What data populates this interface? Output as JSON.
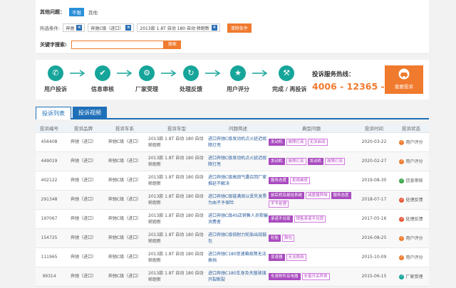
{
  "filters": {
    "other_label": "其他问题：",
    "other_options": [
      "不限",
      "其他"
    ],
    "selected_label": "所选条件:",
    "chips": [
      "奔驰",
      "奔驰C级（进口）",
      "2013款 1.8T 自动 180 自动 轿跑新"
    ],
    "clear_label": "清除条件",
    "keyword_label": "关键字搜索:",
    "keyword_placeholder": "",
    "search_label": "搜索"
  },
  "process": {
    "steps": [
      {
        "label": "用户投诉",
        "icon": "phone-icon",
        "glyph": "✆"
      },
      {
        "label": "信息审核",
        "icon": "check-icon",
        "glyph": "✔"
      },
      {
        "label": "厂家受理",
        "icon": "gear-icon",
        "glyph": "⚙"
      },
      {
        "label": "处理反馈",
        "icon": "refresh-icon",
        "glyph": "↻"
      },
      {
        "label": "用户评分",
        "icon": "star-icon",
        "glyph": "★"
      },
      {
        "label": "完成 / 再投诉",
        "icon": "gavel-icon",
        "glyph": "⚒"
      }
    ],
    "hotline_label": "投诉服务热线：",
    "hotline_number": "4006 - 12365 - 0",
    "complain_label": "我要投诉"
  },
  "tabs": [
    "投诉列表",
    "投诉视频"
  ],
  "table": {
    "headers": [
      "投诉编号",
      "投诉品牌",
      "投诉车系",
      "投诉车型",
      "问题简述",
      "典型问题",
      "投诉时间",
      "投诉状态"
    ],
    "rows": [
      {
        "id": "456408",
        "brand": "奔驰（进口）",
        "series": "奔驰C级（进口）",
        "model": "2013款 1.8T 自动 180 自动 轿跑新",
        "summary": "进口奔驰C级发动机点火延迟故障灯亮",
        "tags": [
          {
            "t": "发动机",
            "k": "p"
          },
          {
            "t": "故障灯亮",
            "k": "o"
          },
          {
            "t": "无法启动",
            "k": "o"
          }
        ],
        "date": "2020-03-22",
        "status": "用户评分",
        "scolor": "#f07a2e"
      },
      {
        "id": "449019",
        "brand": "奔驰（进口）",
        "series": "奔驰C级（进口）",
        "model": "2013款 1.8T 自动 180 自动 轿跑新",
        "summary": "进口奔驰C级发动机点火延迟故障灯亮",
        "tags": [
          {
            "t": "发动机",
            "k": "p"
          },
          {
            "t": "故障灯亮",
            "k": "o"
          },
          {
            "t": "发动机",
            "k": "p"
          },
          {
            "t": "故障灯亮",
            "k": "o"
          }
        ],
        "date": "2020-02-27",
        "status": "用户评分",
        "scolor": "#f07a2e"
      },
      {
        "id": "402122",
        "brand": "奔驰（进口）",
        "series": "奔驰C级（进口）",
        "model": "2013款 1.8T 自动 180 自动 轿跑新",
        "summary": "进口奔驰C级高田气囊召回厂家推延不解决",
        "tags": [
          {
            "t": "服务态度",
            "k": "p"
          },
          {
            "t": "拒绝维修",
            "k": "o"
          }
        ],
        "date": "2019-08-30",
        "status": "信息审核",
        "scolor": "#3aa64a"
      },
      {
        "id": "291348",
        "brand": "奔驰（进口）",
        "series": "奔驰C级（进口）",
        "model": "2013款 1.8T 自动 180 自动 轿跑新",
        "summary": "进口奔驰C级链满周以丢失发票为由不予保险",
        "tags": [
          {
            "t": "前后桥及悬挂系统",
            "k": "p"
          },
          {
            "t": "减震器异响",
            "k": "o"
          },
          {
            "t": "服务态度",
            "k": "p"
          },
          {
            "t": "不予处理",
            "k": "o"
          }
        ],
        "date": "2018-07-17",
        "status": "处理反馈",
        "scolor": "#e85a3a"
      },
      {
        "id": "197067",
        "brand": "奔驰（进口）",
        "series": "奔驰C级（进口）",
        "model": "2013款 1.8T 自动 180 自动 轿跑新",
        "summary": "进口奔驰C级4S店销售人员欺骗消费者",
        "tags": [
          {
            "t": "承诺不兑现",
            "k": "p"
          },
          {
            "t": "销售承诺不兑现",
            "k": "o"
          }
        ],
        "date": "2017-05-16",
        "status": "处理反馈",
        "scolor": "#e85a3a"
      },
      {
        "id": "154725",
        "brand": "奔驰（进口）",
        "series": "奔驰C级（进口）",
        "model": "2013款 1.8T 自动 180 自动 轿跑新",
        "summary": "进口奔驰C级倍耐力轮胎出现鼓包",
        "tags": [
          {
            "t": "轮胎",
            "k": "p"
          },
          {
            "t": "鼓包",
            "k": "o"
          }
        ],
        "date": "2016-08-25",
        "status": "用户评分",
        "scolor": "#f07a2e"
      },
      {
        "id": "111965",
        "brand": "奔驰（进口）",
        "series": "奔驰C级（进口）",
        "model": "2013款 1.8T 自动 180 自动 轿跑新",
        "summary": "进口奔驰C180变速箱故障无法换挡",
        "tags": [
          {
            "t": "变速器",
            "k": "p"
          },
          {
            "t": "无法换挡",
            "k": "o"
          }
        ],
        "date": "2015-10-09",
        "status": "用户评分",
        "scolor": "#f07a2e"
      },
      {
        "id": "99314",
        "brand": "奔驰（进口）",
        "series": "奔驰C级（进口）",
        "model": "2013款 1.8T 自动 180 自动 轿跑新",
        "summary": "进口奔驰C180车身及天窗玻璃开裂断裂",
        "tags": [
          {
            "t": "车身附件及电器",
            "k": "p"
          },
          {
            "t": "车窗开关异常",
            "k": "o"
          }
        ],
        "date": "2015-06-15",
        "status": "厂家受理",
        "scolor": "#16a59a"
      }
    ]
  }
}
